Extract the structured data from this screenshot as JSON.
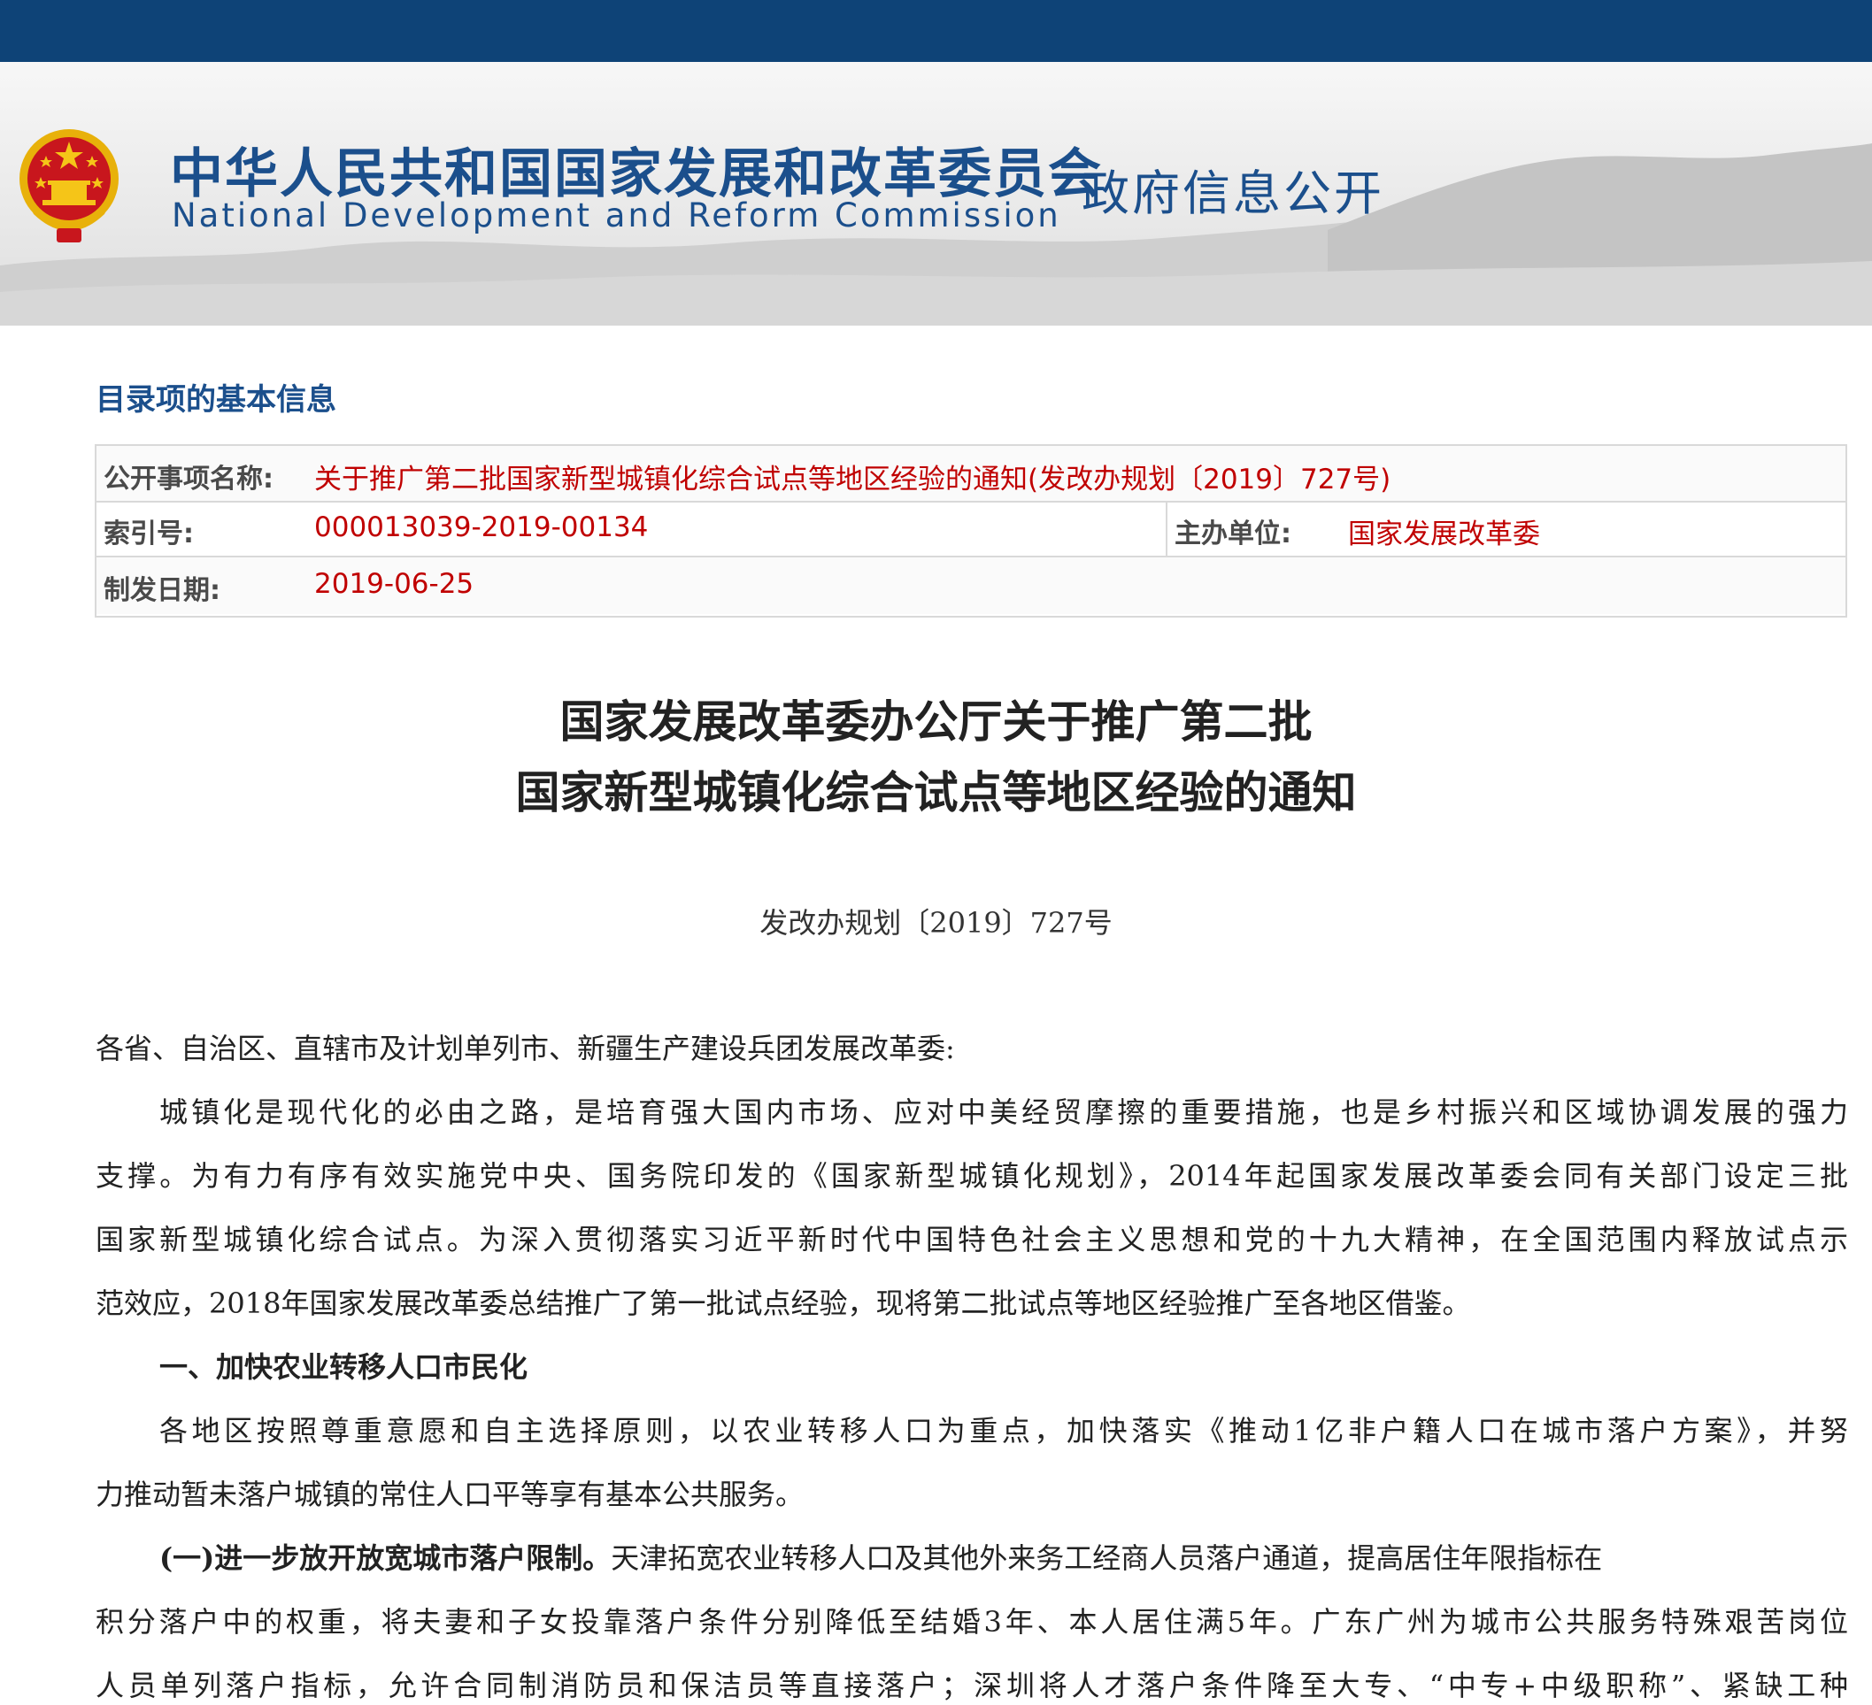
{
  "header": {
    "site_title_cn": "中华人民共和国国家发展和改革委员会",
    "site_title_en": "National Development and Reform Commission",
    "section_name": "政府信息公开",
    "brand_color": "#0e4377",
    "title_color": "#1b4f8c",
    "emblem_icon": "national-emblem-icon"
  },
  "info": {
    "heading": "目录项的基本信息",
    "item_name_label": "公开事项名称:",
    "item_name_value": "关于推广第二批国家新型城镇化综合试点等地区经验的通知(发改办规划〔2019〕727号)",
    "index_label": "索引号:",
    "index_value": "000013039-2019-00134",
    "host_label": "主办单位:",
    "host_value": "国家发展改革委",
    "date_label": "制发日期:",
    "date_value": "2019-06-25",
    "value_color": "#c00000"
  },
  "document": {
    "title_line1": "国家发展改革委办公厅关于推广第二批",
    "title_line2": "国家新型城镇化综合试点等地区经验的通知",
    "doc_number": "发改办规划〔2019〕727号",
    "lines": [
      "各省、自治区、直辖市及计划单列市、新疆生产建设兵团发展改革委:",
      "城镇化是现代化的必由之路，是培育强大国内市场、应对中美经贸摩擦的重要措施，也是乡村振兴和区域协调发展的强力",
      "支撑。为有力有序有效实施党中央、国务院印发的《国家新型城镇化规划》，2014年起国家发展改革委会同有关部门设定三批",
      "国家新型城镇化综合试点。为深入贯彻落实习近平新时代中国特色社会主义思想和党的十九大精神，在全国范围内释放试点示",
      "范效应，2018年国家发展改革委总结推广了第一批试点经验，现将第二批试点等地区经验推广至各地区借鉴。",
      "一、加快农业转移人口市民化",
      "各地区按照尊重意愿和自主选择原则，以农业转移人口为重点，加快落实《推动1亿非户籍人口在城市落户方案》，并努",
      "力推动暂未落户城镇的常住人口平等享有基本公共服务。",
      "(一)进一步放开放宽城市落户限制。",
      "天津拓宽农业转移人口及其他外来务工经商人员落户通道，提高居住年限指标在",
      "积分落户中的权重，将夫妻和子女投靠落户条件分别降低至结婚3年、本人居住满5年。广东广州为城市公共服务特殊艰苦岗位",
      "人员单列落户指标，允许合同制消防员和保洁员等直接落户；深圳将人才落户条件降至大专、“中专+中级职称”、紧缺工种"
    ]
  }
}
